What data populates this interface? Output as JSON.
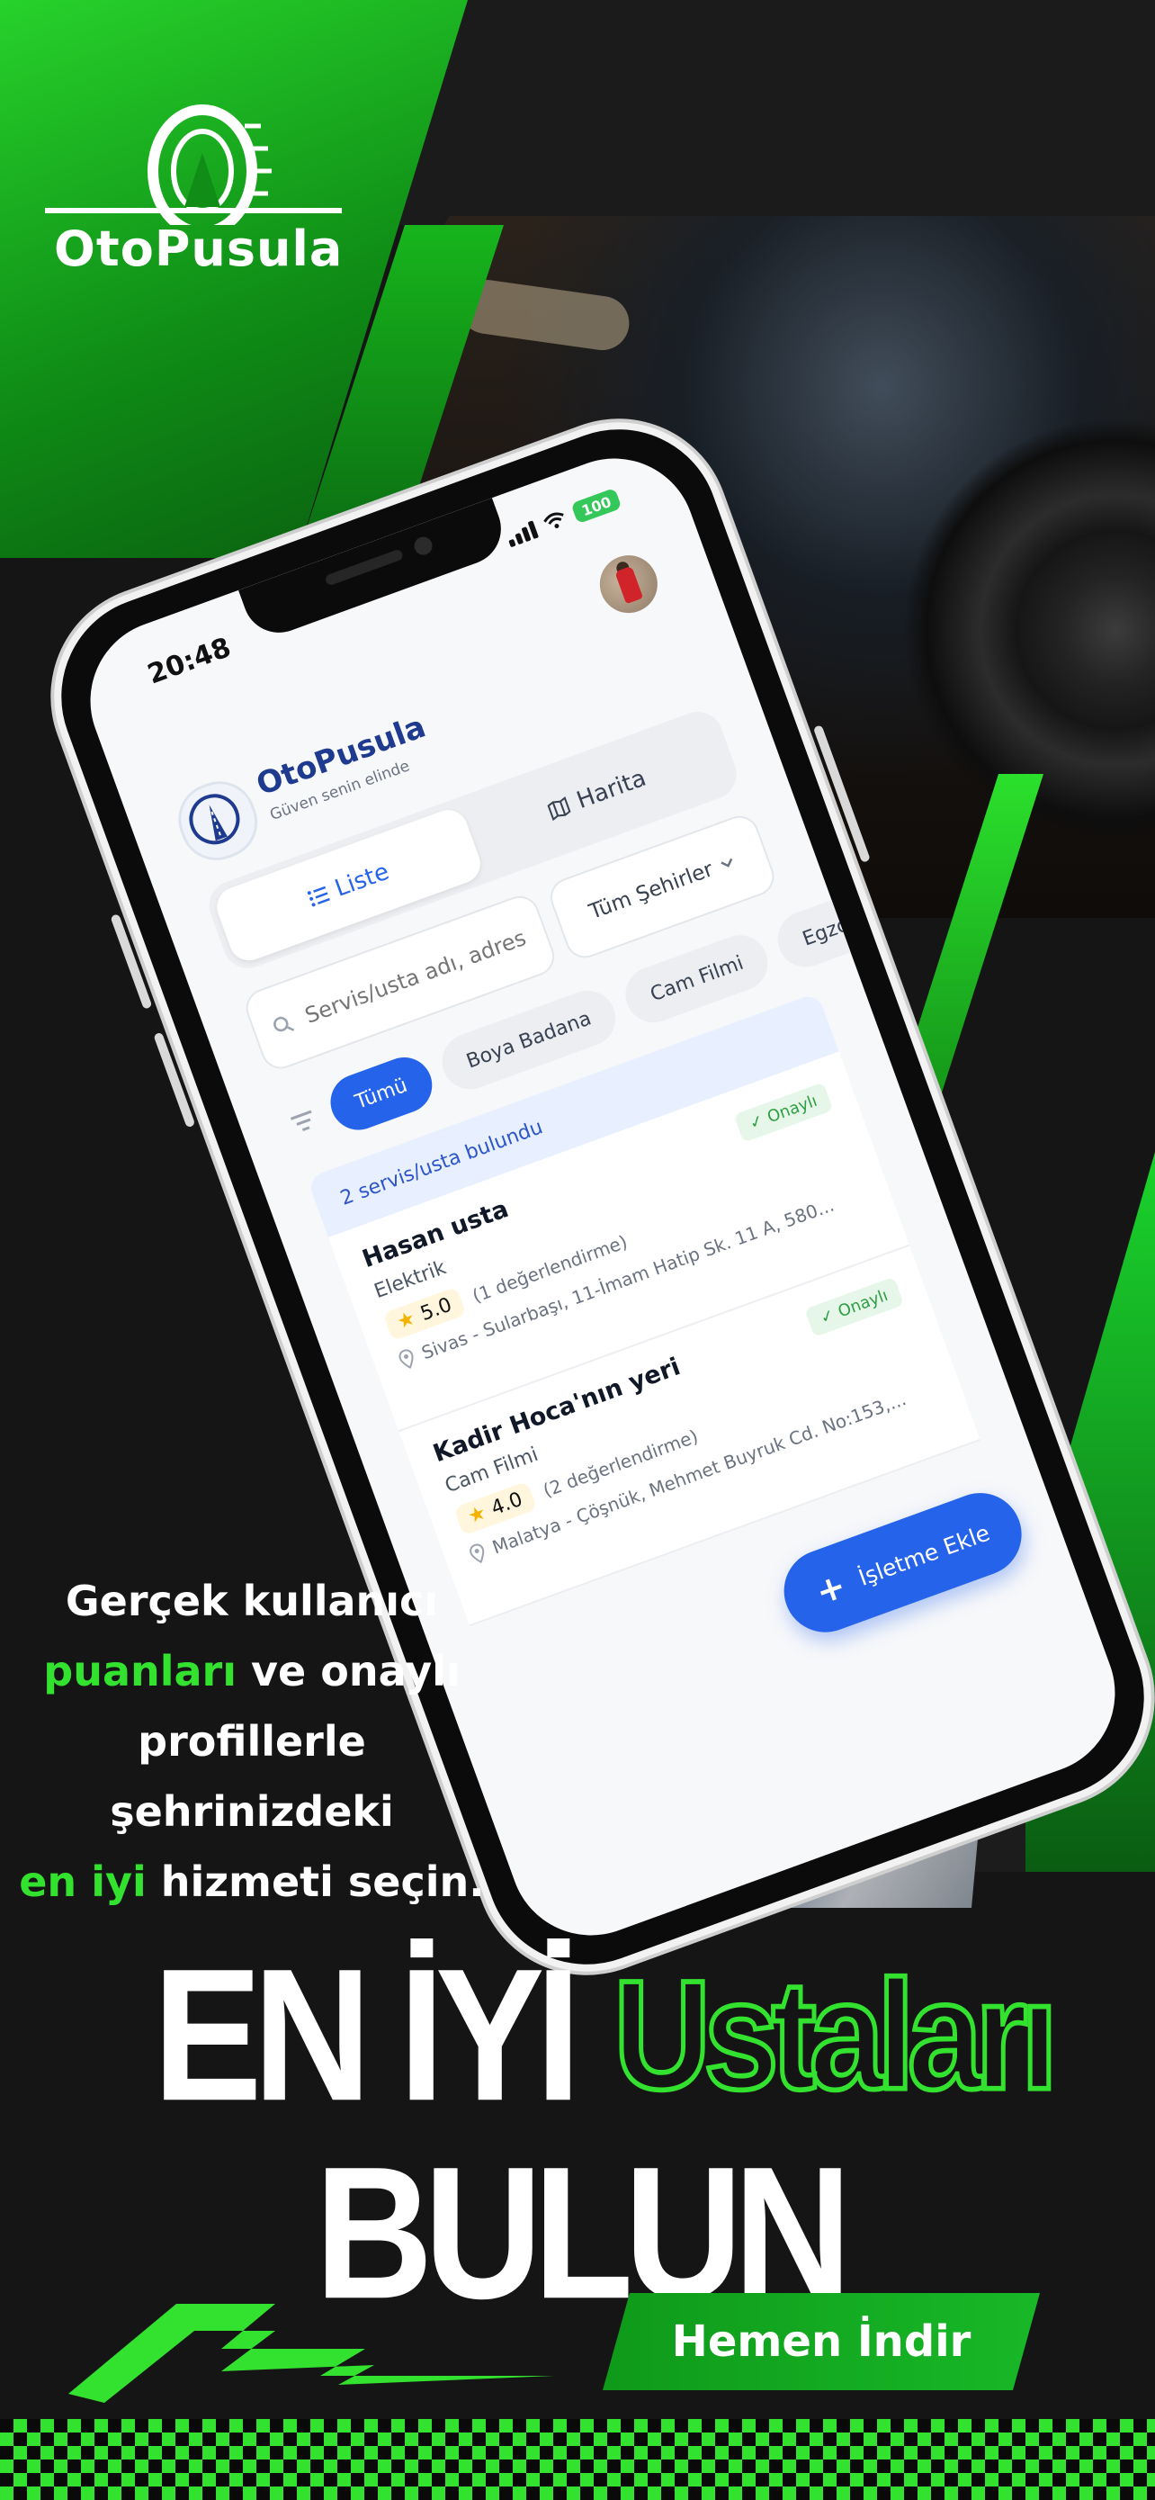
{
  "brand": {
    "name": "OtoPusula",
    "accent_green": "#33e22f",
    "logo_icon": "tire-road-icon"
  },
  "phone": {
    "status_time": "20:48",
    "battery": "100",
    "app": {
      "title": "OtoPusula",
      "subtitle": "Güven senin elinde",
      "logo_icon": "compass-road-icon",
      "avatar_icon": "user-avatar",
      "tabs": [
        {
          "label": "Liste",
          "icon": "list-icon",
          "active": true
        },
        {
          "label": "Harita",
          "icon": "map-icon",
          "active": false
        }
      ],
      "search": {
        "placeholder": "Servis/usta adı, adres..."
      },
      "city_select": {
        "value": "Tüm Şehirler"
      },
      "chips": [
        "Tümü",
        "Boya Badana",
        "Cam Filmi",
        "Egzoz S..."
      ],
      "results_text": "2 servis/usta bulundu",
      "results": [
        {
          "name": "Hasan usta",
          "category": "Elektrik",
          "rating": "5.0",
          "reviews": "(1 değerlendirme)",
          "address": "Sivas - Sularbaşı, 11-İmam Hatip Sk. 11 A, 580...",
          "badge": "Onaylı"
        },
        {
          "name": "Kadir Hoca'nın yeri",
          "category": "Cam Filmi",
          "rating": "4.0",
          "reviews": "(2 değerlendirme)",
          "address": "Malatya - Çöşnük, Mehmet Buyruk Cd. No:153,...",
          "badge": "Onaylı"
        }
      ],
      "add_button": "İşletme Ekle"
    }
  },
  "promo": {
    "line1": "Gerçek kullanıcı",
    "line2_hl": "puanları",
    "line2_rest": " ve onaylı",
    "line3": "profillerle",
    "line4": "şehrinizdeki",
    "line5_hl": "en iyi",
    "line5_rest": " hizmeti seçin."
  },
  "headline": {
    "part1": "EN İYİ",
    "part2": "Ustaları",
    "part3": "BULUN"
  },
  "cta": {
    "label": "Hemen İndir"
  }
}
